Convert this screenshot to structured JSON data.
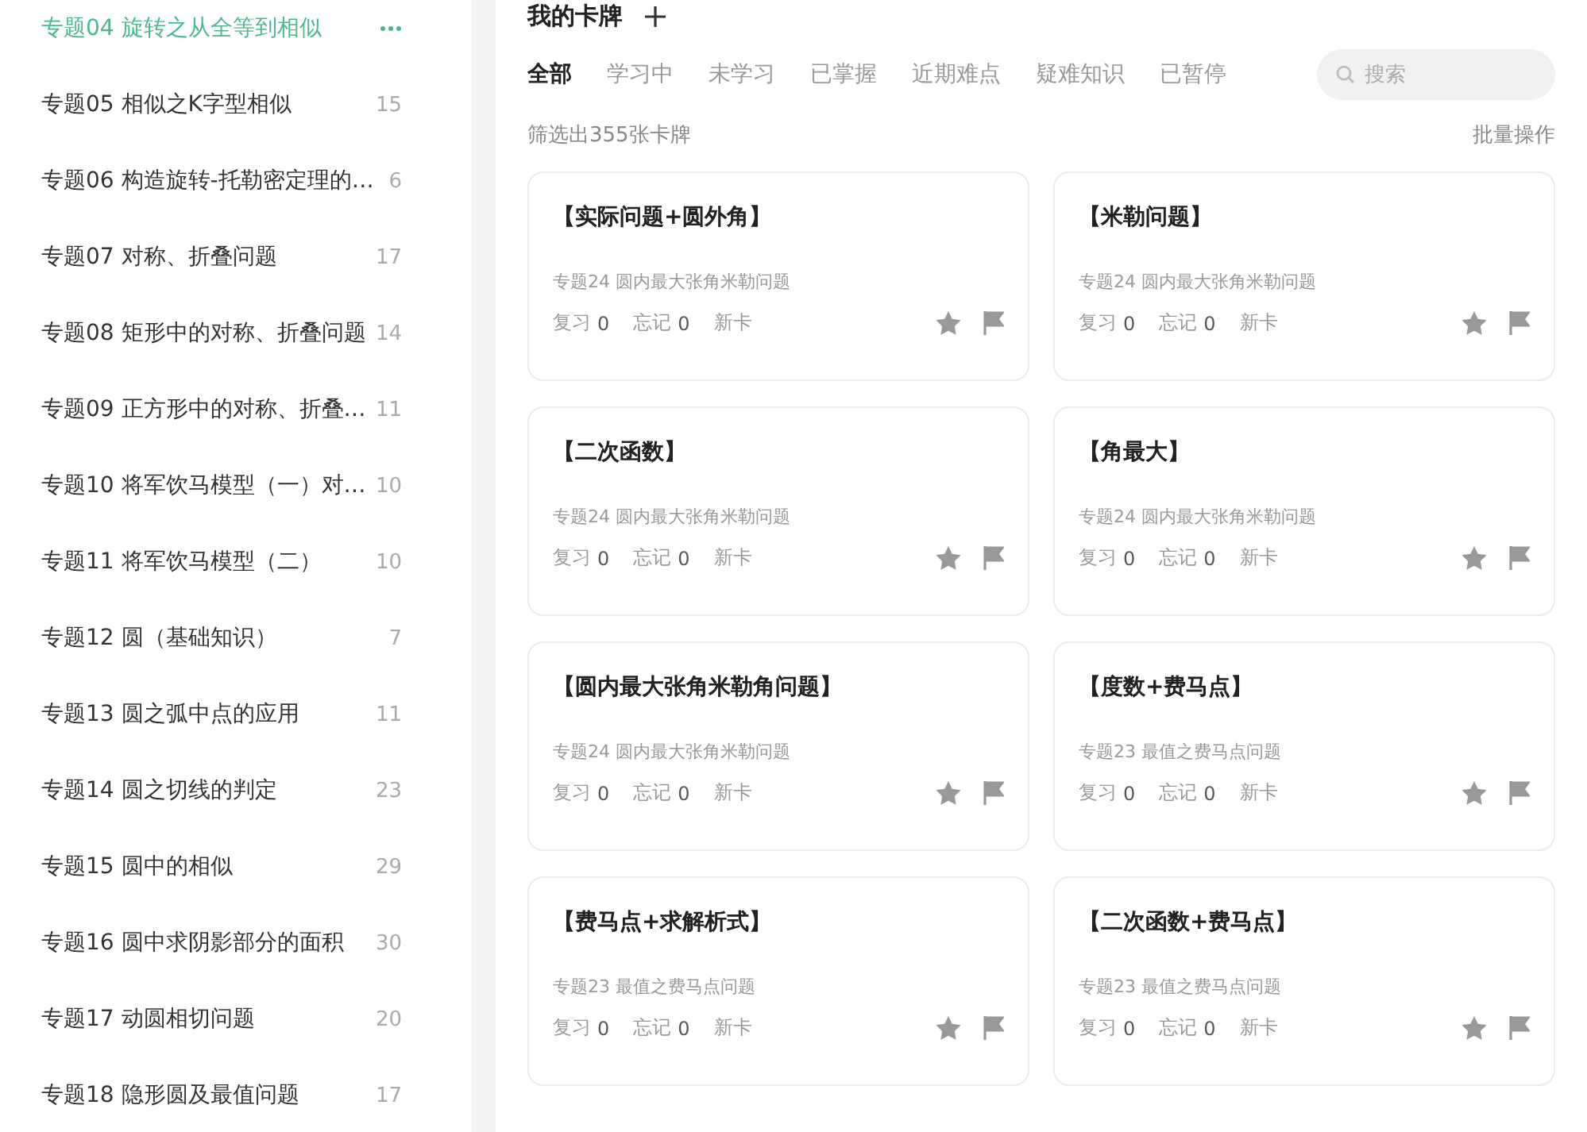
{
  "sidebar": {
    "items": [
      {
        "label": "专题04 旋转之从全等到相似",
        "selected": true
      },
      {
        "label": "专题05 相似之K字型相似",
        "count": "15",
        "selected": false
      },
      {
        "label": "专题06 构造旋转-托勒密定理的…",
        "count": "6",
        "selected": false
      },
      {
        "label": "专题07 对称、折叠问题",
        "count": "17",
        "selected": false
      },
      {
        "label": "专题08 矩形中的对称、折叠问题",
        "count": "14",
        "selected": false
      },
      {
        "label": "专题09 正方形中的对称、折叠…",
        "count": "11",
        "selected": false
      },
      {
        "label": "专题10 将军饮马模型（一）对…",
        "count": "10",
        "selected": false
      },
      {
        "label": "专题11 将军饮马模型（二）",
        "count": "10",
        "selected": false
      },
      {
        "label": "专题12 圆（基础知识）",
        "count": "7",
        "selected": false
      },
      {
        "label": "专题13 圆之弧中点的应用",
        "count": "11",
        "selected": false
      },
      {
        "label": "专题14 圆之切线的判定",
        "count": "23",
        "selected": false
      },
      {
        "label": "专题15 圆中的相似",
        "count": "29",
        "selected": false
      },
      {
        "label": "专题16 圆中求阴影部分的面积",
        "count": "30",
        "selected": false
      },
      {
        "label": "专题17 动圆相切问题",
        "count": "20",
        "selected": false
      },
      {
        "label": "专题18 隐形圆及最值问题",
        "count": "17",
        "selected": false
      }
    ]
  },
  "header": {
    "title": "我的卡牌"
  },
  "tabs": [
    {
      "label": "全部",
      "selected": true
    },
    {
      "label": "学习中",
      "selected": false
    },
    {
      "label": "未学习",
      "selected": false
    },
    {
      "label": "已掌握",
      "selected": false
    },
    {
      "label": "近期难点",
      "selected": false
    },
    {
      "label": "疑难知识",
      "selected": false
    },
    {
      "label": "已暂停",
      "selected": false
    }
  ],
  "search": {
    "placeholder": "搜索"
  },
  "summary": "筛选出355张卡牌",
  "batch_action": "批量操作",
  "cards": [
    {
      "title": "【实际问题+圆外角】",
      "topic": "专题24 圆内最大张角米勒问题",
      "review_label": "复习",
      "review": "0",
      "forget_label": "忘记",
      "forget": "0",
      "status": "新卡"
    },
    {
      "title": "【米勒问题】",
      "topic": "专题24 圆内最大张角米勒问题",
      "review_label": "复习",
      "review": "0",
      "forget_label": "忘记",
      "forget": "0",
      "status": "新卡"
    },
    {
      "title": "【二次函数】",
      "topic": "专题24 圆内最大张角米勒问题",
      "review_label": "复习",
      "review": "0",
      "forget_label": "忘记",
      "forget": "0",
      "status": "新卡"
    },
    {
      "title": "【角最大】",
      "topic": "专题24 圆内最大张角米勒问题",
      "review_label": "复习",
      "review": "0",
      "forget_label": "忘记",
      "forget": "0",
      "status": "新卡"
    },
    {
      "title": "【圆内最大张角米勒角问题】",
      "topic": "专题24 圆内最大张角米勒问题",
      "review_label": "复习",
      "review": "0",
      "forget_label": "忘记",
      "forget": "0",
      "status": "新卡"
    },
    {
      "title": "【度数+费马点】",
      "topic": "专题23 最值之费马点问题",
      "review_label": "复习",
      "review": "0",
      "forget_label": "忘记",
      "forget": "0",
      "status": "新卡"
    },
    {
      "title": "【费马点+求解析式】",
      "topic": "专题23 最值之费马点问题",
      "review_label": "复习",
      "review": "0",
      "forget_label": "忘记",
      "forget": "0",
      "status": "新卡"
    },
    {
      "title": "【二次函数+费马点】",
      "topic": "专题23 最值之费马点问题",
      "review_label": "复习",
      "review": "0",
      "forget_label": "忘记",
      "forget": "0",
      "status": "新卡"
    }
  ]
}
